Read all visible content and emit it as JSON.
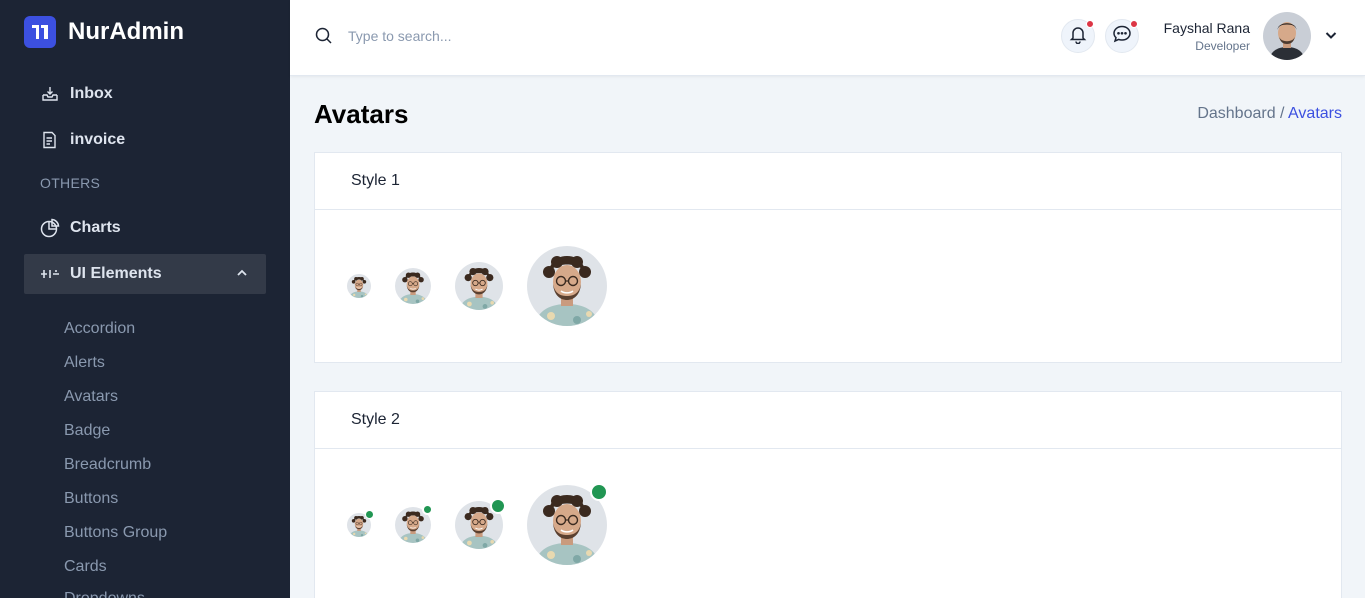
{
  "brand": {
    "name": "NurAdmin",
    "color": "#3c50e0"
  },
  "sidebar": {
    "items": [
      {
        "label": "Inbox",
        "icon": "inbox-icon"
      },
      {
        "label": "invoice",
        "icon": "invoice-icon"
      }
    ],
    "section_title": "OTHERS",
    "others": [
      {
        "label": "Charts",
        "icon": "pie-chart-icon"
      },
      {
        "label": "UI Elements",
        "icon": "sliders-icon",
        "expanded": true
      }
    ],
    "sub_items": [
      "Accordion",
      "Alerts",
      "Avatars",
      "Badge",
      "Breadcrumb",
      "Buttons",
      "Buttons Group",
      "Cards",
      "Dropdowns"
    ]
  },
  "header": {
    "search_placeholder": "Type to search...",
    "notification_icon": "bell-icon",
    "message_icon": "chat-icon",
    "user": {
      "name": "Fayshal Rana",
      "role": "Developer"
    }
  },
  "main": {
    "title": "Avatars",
    "breadcrumb": {
      "parent": "Dashboard /",
      "current": "Avatars"
    },
    "cards": [
      {
        "title": "Style 1",
        "show_status": false
      },
      {
        "title": "Style 2",
        "show_status": true,
        "status_color": "#219653"
      }
    ]
  }
}
